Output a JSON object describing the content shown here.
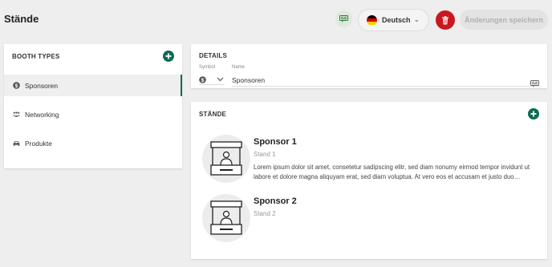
{
  "header": {
    "title": "Stände",
    "language": "Deutsch",
    "save_label": "Änderungen speichern"
  },
  "booth_types": {
    "title": "BOOTH TYPES",
    "items": [
      {
        "label": "Sponsoren",
        "icon": "dollar-icon",
        "active": true
      },
      {
        "label": "Networking",
        "icon": "people-icon",
        "active": false
      },
      {
        "label": "Produkte",
        "icon": "car-icon",
        "active": false
      }
    ]
  },
  "details": {
    "title": "DETAILS",
    "symbol_label": "Symbol",
    "name_label": "Name",
    "name_value": "Sponsoren"
  },
  "staende": {
    "title": "STÄNDE",
    "items": [
      {
        "name": "Sponsor 1",
        "subtitle": "Stand 1",
        "description": "Lorem ipsum dolor sit amet, consetetur sadipscing elitr, sed diam nonumy eirmod tempor invidunt ut labore et dolore magna aliquyam erat, sed diam voluptua. At vero eos et accusam et justo duo dolores et ea rebum."
      },
      {
        "name": "Sponsor 2",
        "subtitle": "Stand 2",
        "description": ""
      }
    ]
  },
  "colors": {
    "accent": "#0e6b55",
    "delete": "#c9181f",
    "background": "#eeeeee"
  }
}
